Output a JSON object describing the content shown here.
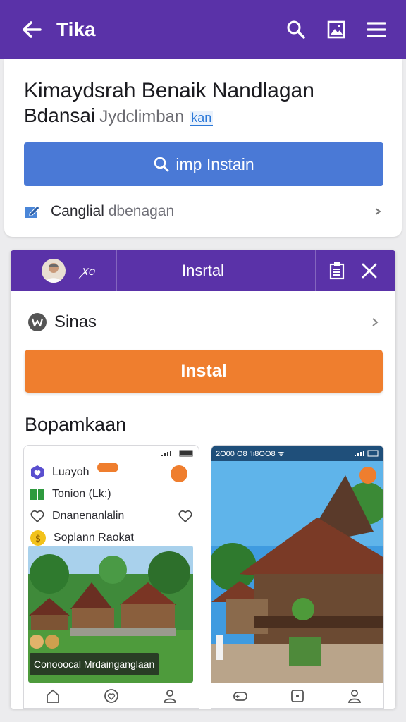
{
  "appbar": {
    "title": "Tika",
    "bg": "#5a32a8",
    "icons": [
      "back-arrow-icon",
      "search-icon",
      "image-icon",
      "menu-icon"
    ]
  },
  "card": {
    "heading_line1": "Kimaydsrah Benaik Nandlagan",
    "heading_line2": "Bdansai",
    "heading_sub": "Jydclimban",
    "heading_tag": "kan",
    "primary_button": "imp Instain",
    "row_label_main": "Canglial",
    "row_label_dim": "dbenagan"
  },
  "dialog": {
    "header_tagline": "ꭗ೦",
    "title": "Insrtal",
    "setting_row": "Sinas",
    "install_button": "Instal",
    "section_title": "Bopamkaan",
    "accent": "#ef7e2e"
  },
  "phone1": {
    "rows": [
      {
        "label": "Luayoh",
        "icon": "heart-badge-icon"
      },
      {
        "label": "Tonion (Lk:)",
        "icon": "book-icon"
      },
      {
        "label": "Dnanenanlalin",
        "icon": "heart-outline-icon"
      },
      {
        "label": "Soplann Raokat",
        "icon": "coin-icon"
      }
    ],
    "caption": "Conooocal Mrdainganglaan"
  },
  "phone2": {
    "status_time": "2O00 O8 'Ii8OO8 ᯤ"
  }
}
